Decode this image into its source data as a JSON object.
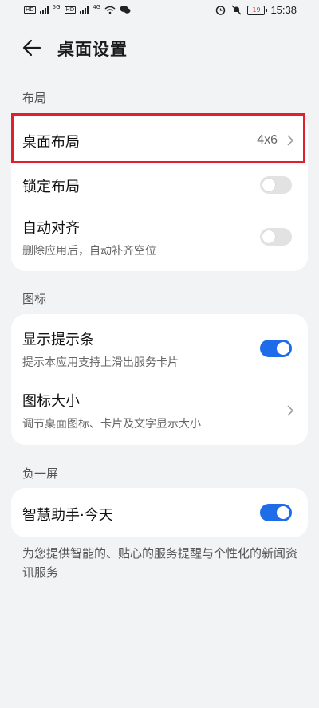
{
  "status_bar": {
    "time": "15:38",
    "battery_level": "19",
    "network_left": "5G",
    "network_right": "4G"
  },
  "header": {
    "title": "桌面设置"
  },
  "sections": {
    "layout": {
      "label": "布局",
      "desktop_layout": {
        "label": "桌面布局",
        "value": "4x6"
      },
      "lock_layout": {
        "label": "锁定布局",
        "enabled": false
      },
      "auto_align": {
        "label": "自动对齐",
        "desc": "删除应用后，自动补齐空位",
        "enabled": false
      }
    },
    "icons": {
      "label": "图标",
      "show_hint_bar": {
        "label": "显示提示条",
        "desc": "提示本应用支持上滑出服务卡片",
        "enabled": true
      },
      "icon_size": {
        "label": "图标大小",
        "desc": "调节桌面图标、卡片及文字显示大小"
      }
    },
    "minus_one": {
      "label": "负一屏",
      "smart_assistant": {
        "label": "智慧助手·今天",
        "enabled": true
      },
      "footnote": "为您提供智能的、贴心的服务提醒与个性化的新闻资讯服务"
    }
  },
  "colors": {
    "accent": "#1f6ce8",
    "highlight": "#e0212d",
    "background": "#f1f3f5"
  }
}
